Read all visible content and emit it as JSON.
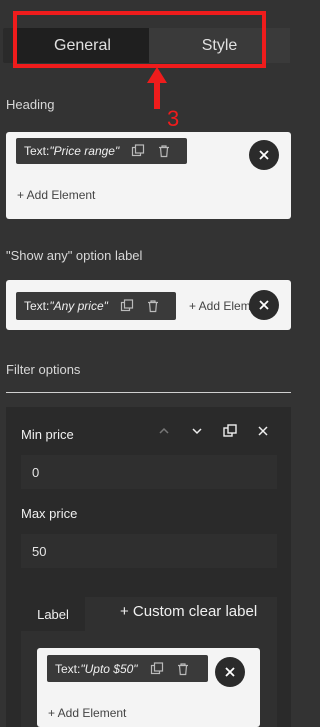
{
  "tabs": {
    "general": "General",
    "style": "Style"
  },
  "annotation": {
    "number": "3"
  },
  "heading_section": {
    "label": "Heading",
    "chip_prefix": "Text: ",
    "chip_value": "\"Price range\"",
    "add_element": "+ Add Element"
  },
  "show_any_section": {
    "label": "\"Show any\" option label",
    "chip_prefix": "Text: ",
    "chip_value": "\"Any price\"",
    "add_element": "+ Add Eleme"
  },
  "filter_options": {
    "label": "Filter options",
    "min_price_label": "Min price",
    "min_price_value": "0",
    "max_price_label": "Max price",
    "max_price_value": "50",
    "sub_tab_label": "Label",
    "custom_clear_label": "+ Custom clear label",
    "chip_prefix": "Text: ",
    "chip_value": "\"Upto $50\"",
    "add_element": "+ Add Element"
  },
  "colors": {
    "annotation_red": "#ef1c1c",
    "background": "#333333"
  }
}
